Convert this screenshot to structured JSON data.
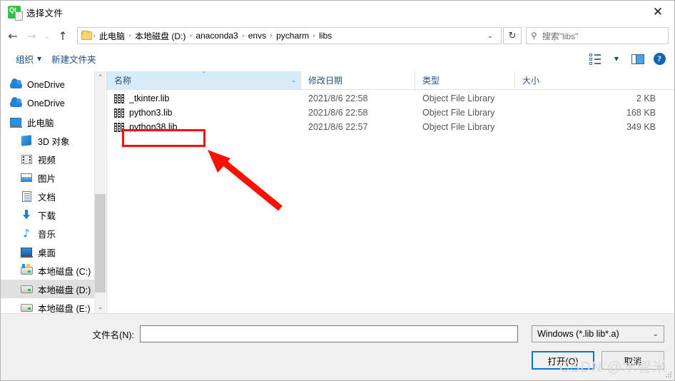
{
  "window": {
    "title": "选择文件",
    "app_icon": "qt-icon",
    "close_label": "✕"
  },
  "navbar": {
    "back_icon": "←",
    "forward_icon": "→",
    "recent_icon": "⌄",
    "up_icon": "↑",
    "breadcrumbs": [
      "此电脑",
      "本地磁盘 (D:)",
      "anaconda3",
      "envs",
      "pycharm",
      "libs"
    ],
    "separator": "›",
    "dropdown_icon": "⌄",
    "refresh_icon": "↻",
    "search": {
      "icon": "search-icon",
      "placeholder": "搜索\"libs\""
    }
  },
  "toolbar": {
    "organize_label": "组织",
    "organize_caret": "▼",
    "new_folder_label": "新建文件夹",
    "view_options_icon": "view-options-icon",
    "view_caret": "▼",
    "preview_pane_icon": "preview-pane-icon",
    "help_label": "?"
  },
  "sidebar": {
    "items": [
      {
        "label": "OneDrive",
        "icon": "cloud-icon",
        "indent": false,
        "selected": false
      },
      {
        "label": "OneDrive",
        "icon": "cloud-icon",
        "indent": false,
        "selected": false
      },
      {
        "label": "此电脑",
        "icon": "computer-icon",
        "indent": false,
        "selected": false
      },
      {
        "label": "3D 对象",
        "icon": "3d-objects-icon",
        "indent": true,
        "selected": false
      },
      {
        "label": "视频",
        "icon": "videos-icon",
        "indent": true,
        "selected": false
      },
      {
        "label": "图片",
        "icon": "pictures-icon",
        "indent": true,
        "selected": false
      },
      {
        "label": "文档",
        "icon": "documents-icon",
        "indent": true,
        "selected": false
      },
      {
        "label": "下载",
        "icon": "downloads-icon",
        "indent": true,
        "selected": false
      },
      {
        "label": "音乐",
        "icon": "music-icon",
        "indent": true,
        "selected": false
      },
      {
        "label": "桌面",
        "icon": "desktop-icon",
        "indent": true,
        "selected": false
      },
      {
        "label": "本地磁盘 (C:)",
        "icon": "system-drive-icon",
        "indent": true,
        "selected": false
      },
      {
        "label": "本地磁盘 (D:)",
        "icon": "drive-icon",
        "indent": true,
        "selected": true
      },
      {
        "label": "本地磁盘 (E:)",
        "icon": "drive-icon",
        "indent": true,
        "selected": false
      }
    ],
    "scroll_up_icon": "⌃",
    "scroll_down_icon": "⌄"
  },
  "filelist": {
    "columns": [
      {
        "key": "name",
        "label": "名称",
        "sorted": true,
        "sort_caret": "⌃"
      },
      {
        "key": "date",
        "label": "修改日期",
        "sorted": false
      },
      {
        "key": "type",
        "label": "类型",
        "sorted": false
      },
      {
        "key": "size",
        "label": "大小",
        "sorted": false
      }
    ],
    "column_chevron": "⌄",
    "rows": [
      {
        "name": "_tkinter.lib",
        "date": "2021/8/6 22:58",
        "type": "Object File Library",
        "size": "2 KB",
        "icon": "library-file-icon"
      },
      {
        "name": "python3.lib",
        "date": "2021/8/6 22:58",
        "type": "Object File Library",
        "size": "168 KB",
        "icon": "library-file-icon"
      },
      {
        "name": "python38.lib",
        "date": "2021/8/6 22:57",
        "type": "Object File Library",
        "size": "349 KB",
        "icon": "library-file-icon"
      }
    ]
  },
  "bottom": {
    "filename_label": "文件名(N):",
    "filename_value": "",
    "filter_value": "Windows (*.lib lib*.a)",
    "filter_chevron": "⌄",
    "open_button": "打开(O)",
    "cancel_button": "取消"
  },
  "annotations": {
    "highlight_color": "#fa1100",
    "highlight_target": "python38.lib",
    "arrow_color": "#fa1100",
    "watermark": "CSDN @木智米"
  }
}
